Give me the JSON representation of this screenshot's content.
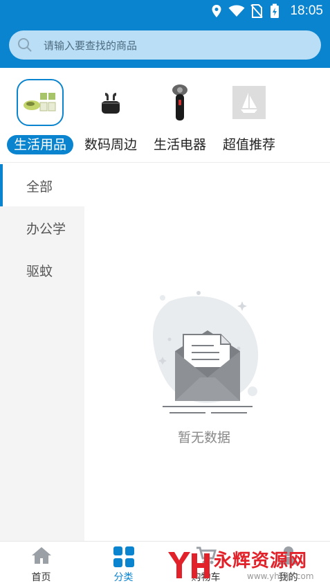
{
  "status_bar": {
    "time": "18:05"
  },
  "search": {
    "placeholder": "请输入要查找的商品"
  },
  "categories": [
    {
      "label": "生活用品",
      "selected": true
    },
    {
      "label": "数码周边",
      "selected": false
    },
    {
      "label": "生活电器",
      "selected": false
    },
    {
      "label": "超值推荐",
      "selected": false
    }
  ],
  "sidebar": {
    "items": [
      {
        "label": "全部",
        "active": true
      },
      {
        "label": "办公学",
        "active": false
      },
      {
        "label": "驱蚊",
        "active": false
      }
    ]
  },
  "empty_state": {
    "text": "暂无数据"
  },
  "tabbar": {
    "items": [
      {
        "label": "首页",
        "icon": "home-icon"
      },
      {
        "label": "分类",
        "icon": "grid-icon"
      },
      {
        "label": "购物车",
        "icon": "cart-icon"
      },
      {
        "label": "我的",
        "icon": "user-icon"
      }
    ]
  },
  "watermark": {
    "brand": "永辉资源网",
    "url": "www.yhkjjc.com"
  },
  "colors": {
    "primary": "#0a84cf",
    "search_bg": "#b9def5",
    "sidebar_bg": "#f4f4f4"
  }
}
